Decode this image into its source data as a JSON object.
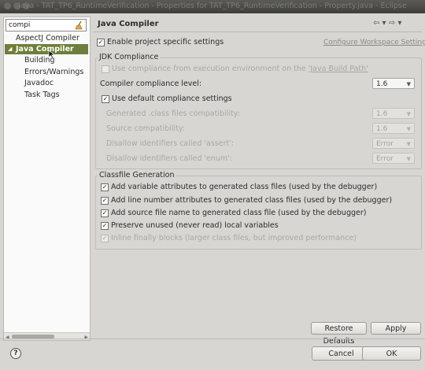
{
  "window": {
    "title": "Java - TAT_TP6_RuntimeVerification - Properties for TAT_TP6_RuntimeVerification - Property.java - Eclipse"
  },
  "filter": {
    "value": "compi"
  },
  "tree": [
    {
      "label": "AspectJ Compiler",
      "selected": false
    },
    {
      "label": "Java Compiler",
      "selected": true
    },
    {
      "label": "Building",
      "selected": false
    },
    {
      "label": "Errors/Warnings",
      "selected": false
    },
    {
      "label": "Javadoc",
      "selected": false
    },
    {
      "label": "Task Tags",
      "selected": false
    }
  ],
  "page": {
    "title": "Java Compiler",
    "nav": "⇦ ▾ ⇨ ▾",
    "enable_project_settings": "Enable project specific settings",
    "configure_workspace_link": "Configure Workspace Settings..."
  },
  "jdk": {
    "group_title": "JDK Compliance",
    "use_build_path": {
      "prefix": "Use compliance from execution environment on the ",
      "link": "'Java Build Path'"
    },
    "compliance_level_label": "Compiler compliance level:",
    "compliance_level_value": "1.6",
    "use_default": "Use default compliance settings",
    "generated_class_label": "Generated .class files compatibility:",
    "generated_class_value": "1.6",
    "source_compat_label": "Source compatibility:",
    "source_compat_value": "1.6",
    "disallow_assert_label": "Disallow identifiers called 'assert':",
    "disallow_assert_value": "Error",
    "disallow_enum_label": "Disallow identifiers called 'enum':",
    "disallow_enum_value": "Error"
  },
  "classfile": {
    "group_title": "Classfile Generation",
    "items": [
      {
        "label": "Add variable attributes to generated class files (used by the debugger)",
        "checked": true,
        "disabled": false
      },
      {
        "label": "Add line number attributes to generated class files (used by the debugger)",
        "checked": true,
        "disabled": false
      },
      {
        "label": "Add source file name to generated class file (used by the debugger)",
        "checked": true,
        "disabled": false
      },
      {
        "label": "Preserve unused (never read) local variables",
        "checked": true,
        "disabled": false
      },
      {
        "label": "Inline finally blocks (larger class files, but improved performance)",
        "checked": true,
        "disabled": true
      }
    ]
  },
  "buttons": {
    "restore_defaults": "Restore Defaults",
    "apply": "Apply",
    "cancel": "Cancel",
    "ok": "OK",
    "help": "?"
  },
  "colors": {
    "selection": "#6e7e3a",
    "background": "#d7d6d3",
    "titlebar": "#3f3e3b"
  }
}
